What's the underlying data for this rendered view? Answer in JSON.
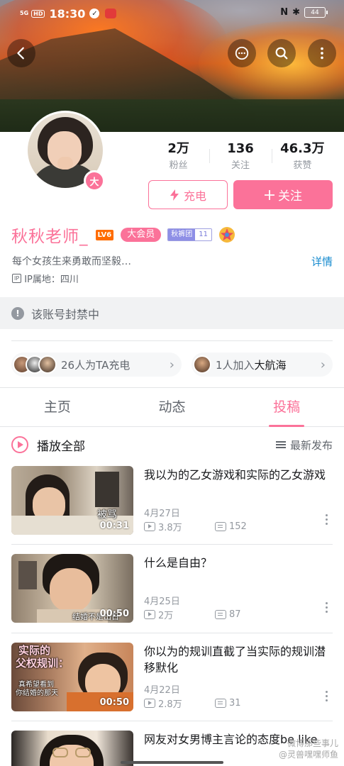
{
  "status_bar": {
    "signal": "5G",
    "hd": "HD",
    "time": "18:30",
    "nfc": "N",
    "battery": "44"
  },
  "header": {
    "back_icon": "back-arrow-icon",
    "message_icon": "chat-bubble-icon",
    "search_icon": "search-icon",
    "more_icon": "vertical-dots-icon"
  },
  "profile": {
    "avatar_badge": "大",
    "name": "秋秋老师_",
    "level": "LV6",
    "vip_label": "大会员",
    "fans_medal_name": "秋裤团",
    "fans_medal_level": "11",
    "signature": "每个女孩生来勇敢而坚毅…",
    "signature_more": "详情",
    "ip_chip": "IP",
    "ip_location": "IP属地：四川"
  },
  "stats": [
    {
      "value": "2万",
      "label": "粉丝"
    },
    {
      "value": "136",
      "label": "关注"
    },
    {
      "value": "46.3万",
      "label": "获赞"
    }
  ],
  "actions": {
    "charge_label": "充电",
    "follow_label": "关注"
  },
  "ban_notice": "该账号封禁中",
  "supporters": {
    "charge_count_text": "26人为TA充电",
    "fleet_text_prefix": "1人加入",
    "fleet_text_highlight": "大航海"
  },
  "tabs": [
    "主页",
    "动态",
    "投稿"
  ],
  "active_tab": "投稿",
  "list_controls": {
    "play_all": "播放全部",
    "sort": "最新发布"
  },
  "videos": [
    {
      "title": "我以为的乙女游戏和实际的乙女游戏",
      "date": "4月27日",
      "views": "3.8万",
      "danmaku": "152",
      "duration": "00:31",
      "overlay": "被骂"
    },
    {
      "title": "什么是自由？",
      "date": "4月25日",
      "views": "2万",
      "danmaku": "87",
      "duration": "00:50",
      "overlay": "结婚不是出日"
    },
    {
      "title": "你以为的规训直截了当实际的规训潜移默化",
      "date": "4月22日",
      "views": "2.8万",
      "danmaku": "31",
      "duration": "00:50",
      "overlay": "实际的",
      "overlay2": "父权规训：",
      "overlay3": "真希望看到",
      "overlay4": "你结婚的那天"
    },
    {
      "title": "网友对女男博主言论的态度be like",
      "date": "",
      "views": "",
      "danmaku": "",
      "duration": "",
      "overlay": ""
    }
  ],
  "watermark": {
    "line1": "微博那些事儿",
    "line2": "@灵兽嘿嘿师鱼"
  },
  "colors": {
    "accent": "#fb7299",
    "link": "#178bcf",
    "vip_level": "#ff6c00",
    "fans_medal": "#8e8fe6"
  }
}
